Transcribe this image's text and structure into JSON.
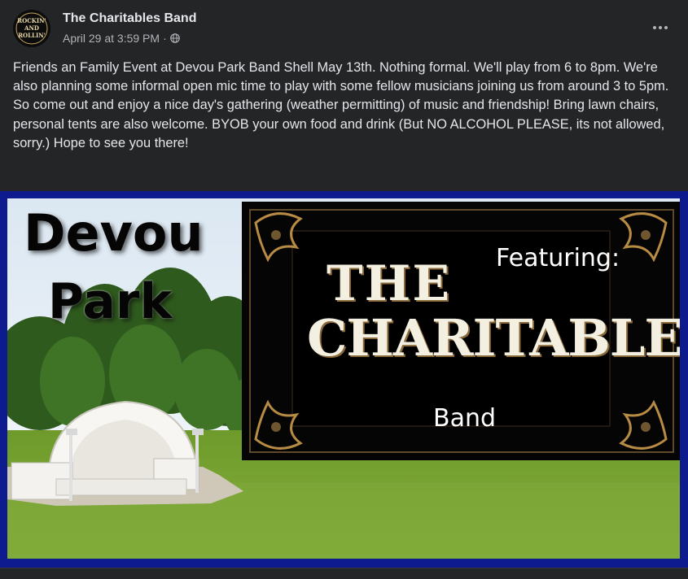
{
  "post": {
    "author": "The Charitables Band",
    "timestamp": "April 29 at 3:59 PM",
    "separator": "·",
    "privacy_icon": "globe-icon",
    "more_icon": "more-options-icon",
    "avatar_text": [
      "ROCKIN'",
      "AND",
      "ROLLIN'"
    ],
    "text_lines": [
      "Friends an Family Event at Devou Park Band Shell May 13th. Nothing formal. We'll play from 6 to 8pm. We're also planning some informal open mic time to play with some fellow musicians joining us from around 3 to 5pm.",
      "So come out and enjoy a nice day's gathering (weather permitting) of music and friendship! Bring lawn chairs, personal tents are also welcome. BYOB your own food and drink (But NO ALCOHOL PLEASE, its not allowed, sorry.) Hope to see you there!"
    ]
  },
  "image": {
    "title_line1": "Devou",
    "title_line2": "Park",
    "featuring": "Featuring:",
    "logo_the": "THE",
    "logo_main": "CHARITABLES",
    "band": "Band",
    "frame_color": "#0e1b8e"
  },
  "colors": {
    "background": "#242526",
    "primary_text": "#e4e6eb",
    "secondary_text": "#b0b3b8"
  }
}
